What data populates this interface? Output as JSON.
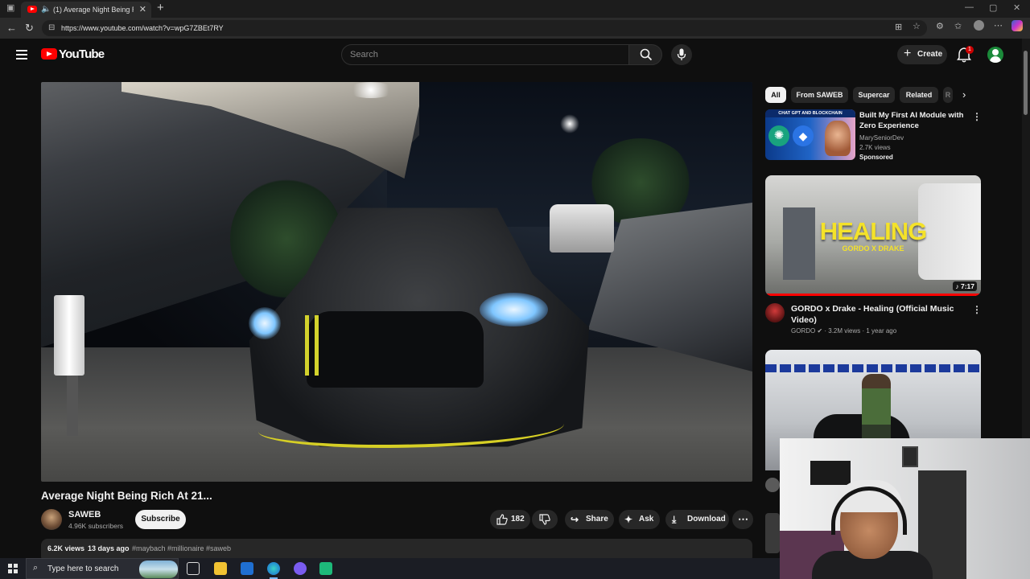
{
  "browser": {
    "tab_title": "(1) Average Night Being Rich At 21...",
    "url": "https://www.youtube.com/watch?v=wpG7ZBEt7RY"
  },
  "masthead": {
    "logo_text": "YouTube",
    "search_placeholder": "Search",
    "create_label": "Create",
    "notification_count": "1"
  },
  "video": {
    "title": "Average Night Being Rich At 21...",
    "channel_name": "SAWEB",
    "subscribers": "4.96K subscribers",
    "subscribe_label": "Subscribe",
    "likes": "182",
    "share_label": "Share",
    "ask_label": "Ask",
    "download_label": "Download",
    "views": "6.2K views",
    "uploaded": "13 days ago",
    "tags": "#maybach #millionaire #saweb"
  },
  "chips": [
    "All",
    "From SAWEB",
    "Supercar",
    "Related",
    "R"
  ],
  "sidebar": {
    "ad": {
      "thumb_banner": "CHAT GPT AND BLOCKCHAIN",
      "title": "Built My First AI Module with Zero Experience",
      "channel": "MarySeniorDev",
      "views": "2.7K views",
      "sponsored": "Sponsored"
    },
    "rec1": {
      "thumb_title": "HEALING",
      "thumb_sub": "GORDO X DRAKE",
      "duration": "7:17",
      "title": "GORDO x Drake - Healing (Official Music Video)",
      "meta": "GORDO ✔ · 3.2M views · 1 year ago"
    }
  },
  "taskbar": {
    "search_text": "Type here to search"
  },
  "colors": {
    "youtube_red": "#ff0000",
    "background": "#0f0f0f",
    "highlight_yellow": "#f4e22a"
  }
}
